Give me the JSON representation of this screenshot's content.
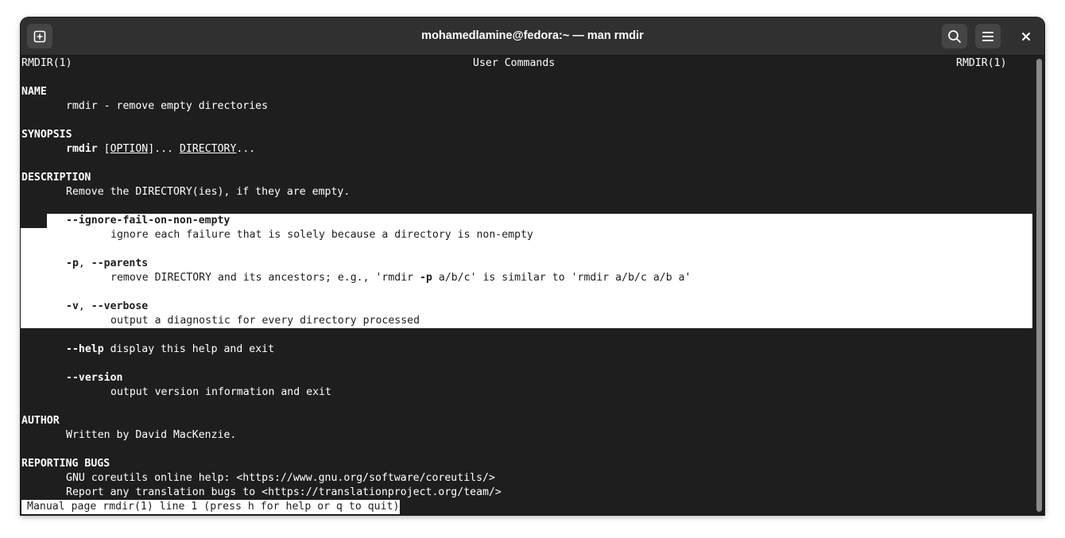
{
  "window": {
    "title": "mohamedlamine@fedora:~ — man rmdir"
  },
  "icons": {
    "new_tab": "new-tab-icon",
    "search": "search-icon",
    "menu": "hamburger-menu-icon",
    "close": "close-icon"
  },
  "man": {
    "header_left": "RMDIR(1)",
    "header_center": "User Commands",
    "header_right": "RMDIR(1)",
    "name_heading": "NAME",
    "name_text": "rmdir - remove empty directories",
    "synopsis_heading": "SYNOPSIS",
    "synopsis_cmd": "rmdir",
    "synopsis_option_open": " [",
    "synopsis_option": "OPTION",
    "synopsis_option_close": "]... ",
    "synopsis_dir": "DIRECTORY",
    "synopsis_dir_tail": "...",
    "description_heading": "DESCRIPTION",
    "description_text": "Remove the DIRECTORY(ies), if they are empty.",
    "opt_ignore": "--ignore-fail-on-non-empty",
    "opt_ignore_desc": "ignore each failure that is solely because a directory is non-empty",
    "opt_p_short": "-p",
    "opt_sep": ", ",
    "opt_p_long": "--parents",
    "opt_p_desc_pre": "remove DIRECTORY and its ancestors; e.g., 'rmdir ",
    "opt_p_desc_flag": "-p",
    "opt_p_desc_post": " a/b/c' is similar to 'rmdir a/b/c a/b a'",
    "opt_v_short": "-v",
    "opt_v_long": "--verbose",
    "opt_v_desc": "output a diagnostic for every directory processed",
    "opt_help": "--help",
    "opt_help_desc": " display this help and exit",
    "opt_version": "--version",
    "opt_version_desc": "output version information and exit",
    "author_heading": "AUTHOR",
    "author_text": "Written by David MacKenzie.",
    "bugs_heading": "REPORTING BUGS",
    "bugs_line1": "GNU coreutils online help: <https://www.gnu.org/software/coreutils/>",
    "bugs_line2": "Report any translation bugs to <https://translationproject.org/team/>"
  },
  "status": {
    "text": "Manual page rmdir(1) line 1 (press h for help or q to quit)"
  }
}
